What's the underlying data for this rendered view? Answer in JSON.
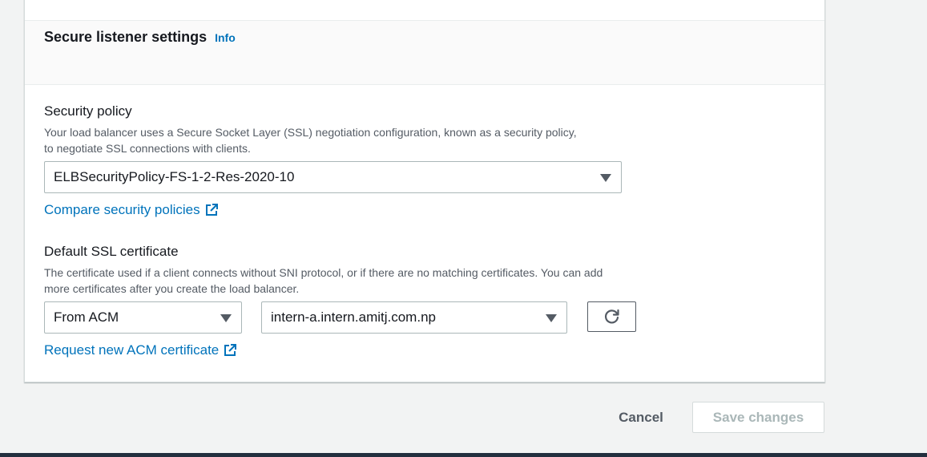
{
  "section": {
    "title": "Secure listener settings",
    "info_link": "Info"
  },
  "security_policy": {
    "label": "Security policy",
    "description_line1": "Your load balancer uses a Secure Socket Layer (SSL) negotiation configuration, known as a security policy,",
    "description_line2": "to negotiate SSL connections with clients.",
    "selected": "ELBSecurityPolicy-FS-1-2-Res-2020-10",
    "compare_link": "Compare security policies"
  },
  "default_ssl_certificate": {
    "label": "Default SSL certificate",
    "description_line1": "The certificate used if a client connects without SNI protocol, or if there are no matching certificates. You can add",
    "description_line2": "more certificates after you create the load balancer.",
    "source_selected": "From ACM",
    "certificate_selected": "intern-a.intern.amitj.com.np",
    "request_link": "Request new ACM certificate"
  },
  "footer": {
    "cancel_label": "Cancel",
    "save_label": "Save changes"
  },
  "icons": {
    "external_link": "external-link-icon",
    "refresh": "refresh-icon",
    "caret": "caret-down-icon"
  },
  "colors": {
    "link": "#0073bb",
    "text": "#16191f",
    "secondary_text": "#545b64",
    "disabled": "#aab7b8",
    "bottom_bar": "#232f3e"
  }
}
